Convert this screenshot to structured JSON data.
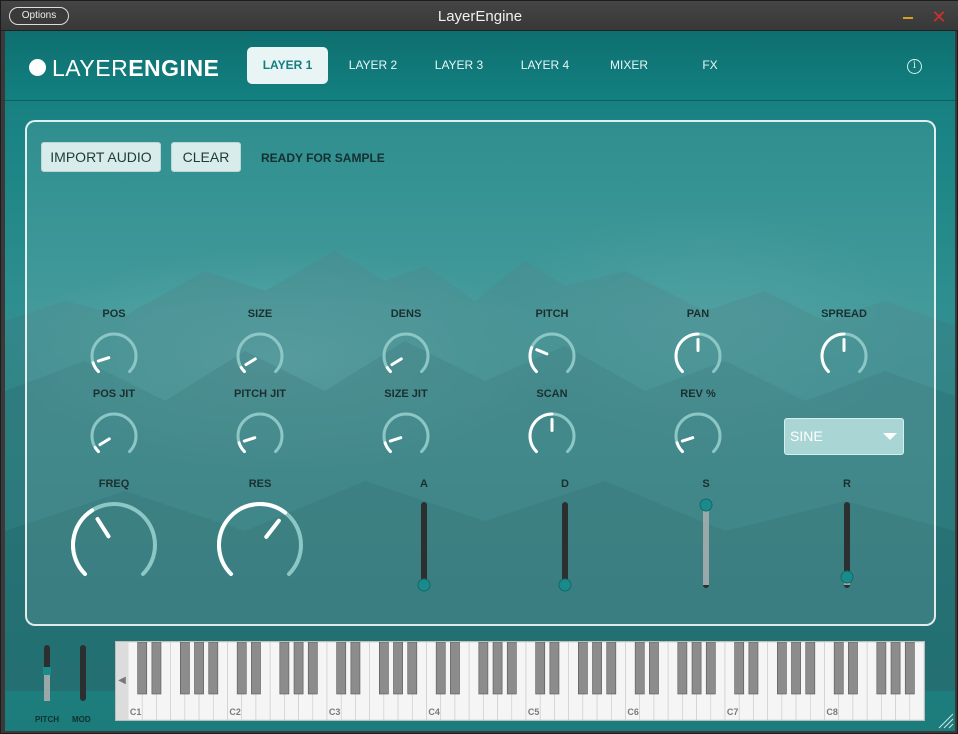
{
  "window": {
    "title": "LayerEngine",
    "options_label": "Options",
    "minimize_icon": "minimize-icon",
    "close_icon": "close-icon"
  },
  "header": {
    "logo_light": "LAYER",
    "logo_bold": "ENGINE",
    "tabs": [
      {
        "label": "LAYER 1",
        "active": true
      },
      {
        "label": "LAYER 2",
        "active": false
      },
      {
        "label": "LAYER 3",
        "active": false
      },
      {
        "label": "LAYER 4",
        "active": false
      },
      {
        "label": "MIXER",
        "active": false
      },
      {
        "label": "FX",
        "active": false
      }
    ],
    "info_icon": "info-icon",
    "info_glyph": "i"
  },
  "panel": {
    "import_label": "IMPORT AUDIO",
    "clear_label": "CLEAR",
    "status": "READY FOR SAMPLE",
    "knobs_row1": [
      {
        "label": "POS",
        "value": 0.1
      },
      {
        "label": "SIZE",
        "value": 0.05
      },
      {
        "label": "DENS",
        "value": 0.05
      },
      {
        "label": "PITCH",
        "value": 0.25
      },
      {
        "label": "PAN",
        "value": 0.5
      },
      {
        "label": "SPREAD",
        "value": 0.5
      }
    ],
    "knobs_row2": [
      {
        "label": "POS JIT",
        "value": 0.05
      },
      {
        "label": "PITCH JIT",
        "value": 0.1
      },
      {
        "label": "SIZE JIT",
        "value": 0.1
      },
      {
        "label": "SCAN",
        "value": 0.5
      },
      {
        "label": "REV %",
        "value": 0.1
      }
    ],
    "wave_select": {
      "value": "SINE",
      "arrow_icon": "chevron-down-icon"
    },
    "filter_knobs": [
      {
        "label": "FREQ",
        "value": 0.38
      },
      {
        "label": "RES",
        "value": 0.64
      }
    ],
    "envelope": [
      {
        "label": "A",
        "value": 0.0
      },
      {
        "label": "D",
        "value": 0.0
      },
      {
        "label": "S",
        "value": 1.0
      },
      {
        "label": "R",
        "value": 0.1
      }
    ]
  },
  "bottom": {
    "pitch_label": "PITCH",
    "mod_label": "MOD",
    "pitch_value": 0.5,
    "mod_value": 0.0,
    "octave_labels": [
      "C1",
      "C2",
      "C3",
      "C4",
      "C5",
      "C6",
      "C7",
      "C8"
    ],
    "scroll_icon": "scroll-left-icon",
    "scroll_glyph": "◀"
  },
  "colors": {
    "accent": "#137e7e",
    "knob_track": "#9fd0d0",
    "slider_thumb": "#1a8a8a"
  }
}
